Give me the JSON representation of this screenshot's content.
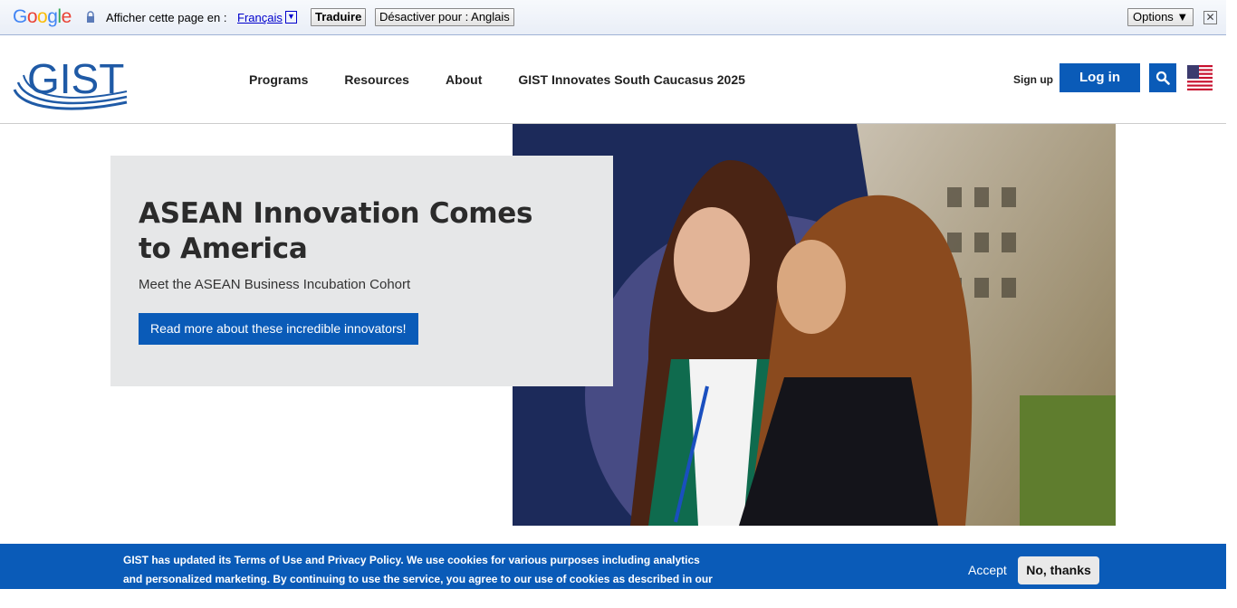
{
  "translate_bar": {
    "logo_text": "Google",
    "prompt": "Afficher cette page en :",
    "language": "Français",
    "translate_label": "Traduire",
    "disable_label": "Désactiver pour : Anglais",
    "options_label": "Options ▼",
    "close_symbol": "✕"
  },
  "header": {
    "logo_text": "GIST",
    "nav": [
      "Programs",
      "Resources",
      "About",
      "GIST Innovates South Caucasus 2025"
    ],
    "signup_label": "Sign up",
    "login_label": "Log in",
    "brand_color": "#0a5bb8"
  },
  "hero": {
    "title": "ASEAN Innovation Comes to America",
    "subtitle": "Meet the ASEAN Business Incubation Cohort",
    "cta_label": "Read more about these incredible innovators!"
  },
  "cookie_banner": {
    "message": "GIST has updated its Terms of Use and Privacy Policy. We use cookies for various purposes including analytics and personalized marketing. By continuing to use the service, you agree to our use of cookies as described in our ",
    "link_text": "Terms of",
    "accept_label": "Accept",
    "decline_label": "No, thanks"
  }
}
